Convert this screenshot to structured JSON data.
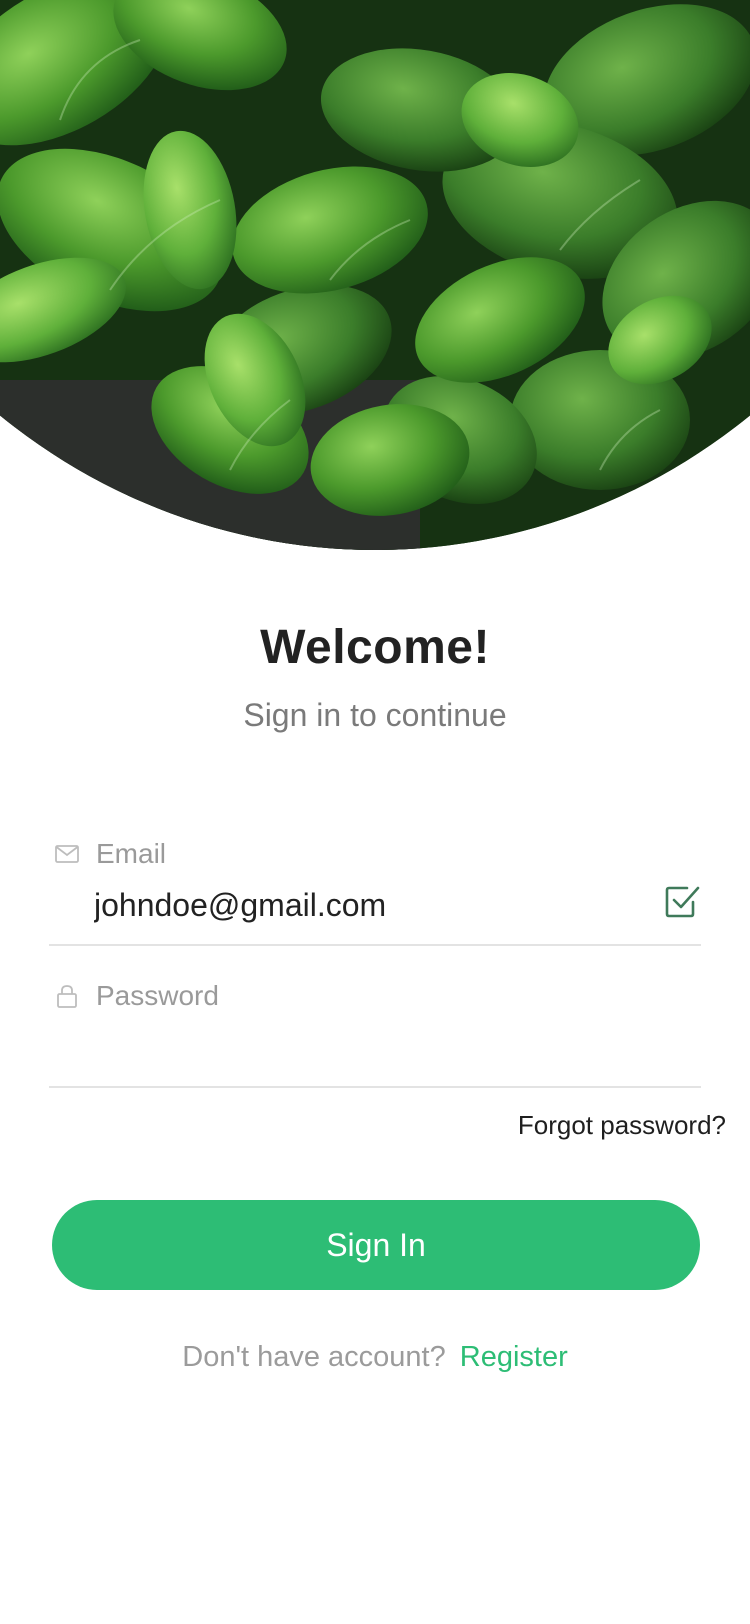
{
  "header": {
    "title": "Welcome!",
    "subtitle": "Sign in to continue"
  },
  "form": {
    "email": {
      "label": "Email",
      "value": "johndoe@gmail.com",
      "icon": "mail-icon",
      "status_icon": "check-square-icon"
    },
    "password": {
      "label": "Password",
      "value": "",
      "icon": "lock-icon"
    },
    "forgot_label": "Forgot password?",
    "submit_label": "Sign In"
  },
  "footer": {
    "question": "Don't have account?",
    "register_label": "Register"
  },
  "colors": {
    "accent": "#2dbd75",
    "check": "#3f7a5a",
    "title": "#222222",
    "muted": "#9b9b9b"
  }
}
